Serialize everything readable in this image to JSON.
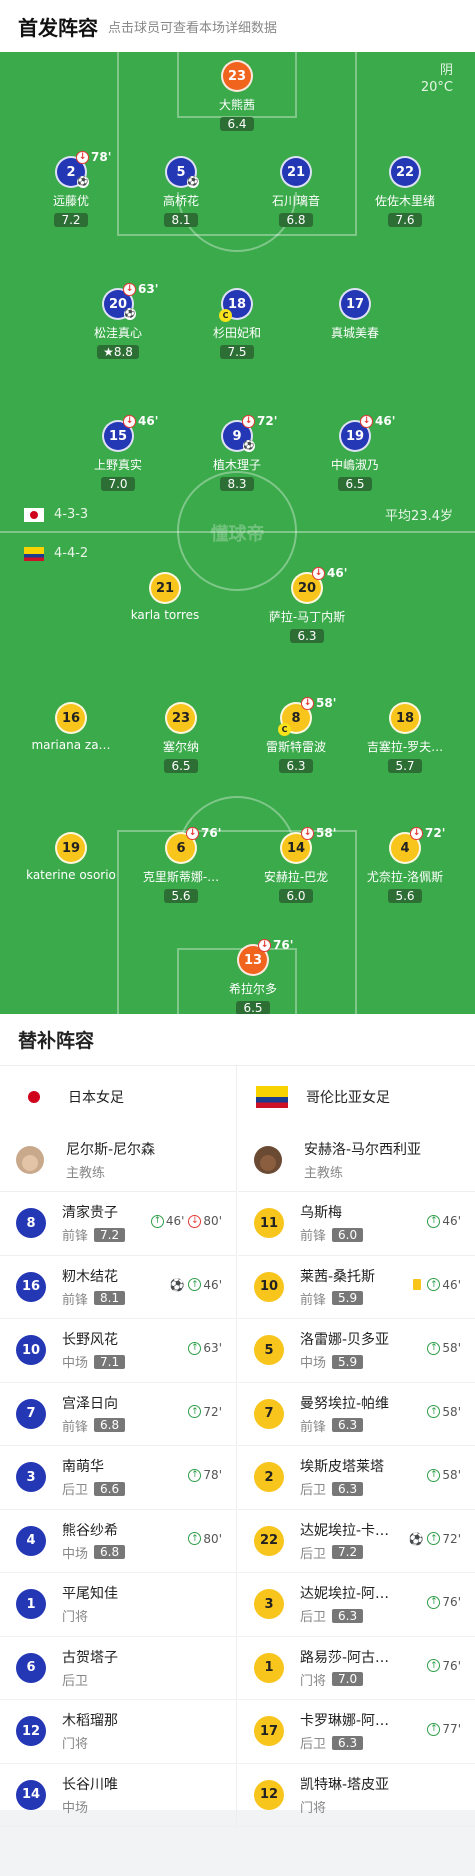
{
  "header": {
    "title": "首发阵容",
    "subtitle": "点击球员可查看本场详细数据"
  },
  "weather": {
    "condition": "阴",
    "temp": "20°C"
  },
  "home": {
    "formation": "4-3-3",
    "avg_age": "平均23.4岁"
  },
  "away": {
    "formation": "4-4-2"
  },
  "watermark": "懂球帝",
  "players": [
    {
      "num": "23",
      "name": "大熊茜",
      "rating": "6.4",
      "color": "orange"
    },
    {
      "num": "2",
      "name": "远藤优",
      "rating": "7.2",
      "color": "blue",
      "sub": "78'",
      "ball": true
    },
    {
      "num": "5",
      "name": "高桥花",
      "rating": "8.1",
      "color": "blue",
      "ball": true
    },
    {
      "num": "21",
      "name": "石川璃音",
      "rating": "6.8",
      "color": "blue"
    },
    {
      "num": "22",
      "name": "佐佐木里绪",
      "rating": "7.6",
      "color": "blue"
    },
    {
      "num": "20",
      "name": "松洼真心",
      "rating": "8.8",
      "color": "blue",
      "sub": "63'",
      "ball": true,
      "star": true
    },
    {
      "num": "18",
      "name": "杉田妃和",
      "rating": "7.5",
      "color": "blue",
      "captain": true
    },
    {
      "num": "17",
      "name": "真城美春",
      "rating": "",
      "color": "blue"
    },
    {
      "num": "15",
      "name": "上野真实",
      "rating": "7.0",
      "color": "blue",
      "sub": "46'"
    },
    {
      "num": "9",
      "name": "植木理子",
      "rating": "8.3",
      "color": "blue",
      "sub": "72'",
      "ball": true
    },
    {
      "num": "19",
      "name": "中嶋淑乃",
      "rating": "6.5",
      "color": "blue",
      "sub": "46'"
    },
    {
      "num": "21",
      "name": "karla torres",
      "rating": "",
      "color": "yellow"
    },
    {
      "num": "20",
      "name": "萨拉-马丁内斯",
      "rating": "6.3",
      "color": "yellow",
      "sub": "46'"
    },
    {
      "num": "16",
      "name": "mariana za…",
      "rating": "",
      "color": "yellow"
    },
    {
      "num": "23",
      "name": "塞尔纳",
      "rating": "6.5",
      "color": "yellow"
    },
    {
      "num": "8",
      "name": "雷斯特雷波",
      "rating": "6.3",
      "color": "yellow",
      "sub": "58'",
      "captain": true
    },
    {
      "num": "18",
      "name": "吉塞拉-罗夫…",
      "rating": "5.7",
      "color": "yellow"
    },
    {
      "num": "19",
      "name": "katerine osorio",
      "rating": "",
      "color": "yellow"
    },
    {
      "num": "6",
      "name": "克里斯蒂娜-…",
      "rating": "5.6",
      "color": "yellow",
      "sub": "76'"
    },
    {
      "num": "14",
      "name": "安赫拉-巴龙",
      "rating": "6.0",
      "color": "yellow",
      "sub": "58'"
    },
    {
      "num": "4",
      "name": "尤奈拉-洛佩斯",
      "rating": "5.6",
      "color": "yellow",
      "sub": "72'"
    },
    {
      "num": "13",
      "name": "希拉尔多",
      "rating": "6.5",
      "color": "orange",
      "sub": "76'"
    }
  ],
  "subs": {
    "title": "替补阵容",
    "home": {
      "team": "日本女足",
      "coach": {
        "name": "尼尔斯-尼尔森",
        "role": "主教练"
      },
      "list": [
        {
          "num": "8",
          "name": "清家贵子",
          "pos": "前锋",
          "rating": "7.2",
          "in": "46'",
          "out": "80'"
        },
        {
          "num": "16",
          "name": "籾木结花",
          "pos": "前锋",
          "rating": "8.1",
          "in": "46'",
          "ball": true
        },
        {
          "num": "10",
          "name": "长野风花",
          "pos": "中场",
          "rating": "7.1",
          "in": "63'"
        },
        {
          "num": "7",
          "name": "宫泽日向",
          "pos": "前锋",
          "rating": "6.8",
          "in": "72'"
        },
        {
          "num": "3",
          "name": "南萌华",
          "pos": "后卫",
          "rating": "6.6",
          "in": "78'"
        },
        {
          "num": "4",
          "name": "熊谷纱希",
          "pos": "中场",
          "rating": "6.8",
          "in": "80'"
        },
        {
          "num": "1",
          "name": "平尾知佳",
          "pos": "门将",
          "rating": ""
        },
        {
          "num": "6",
          "name": "古贺塔子",
          "pos": "后卫",
          "rating": ""
        },
        {
          "num": "12",
          "name": "木稻瑠那",
          "pos": "门将",
          "rating": ""
        },
        {
          "num": "14",
          "name": "长谷川唯",
          "pos": "中场",
          "rating": ""
        }
      ]
    },
    "away": {
      "team": "哥伦比亚女足",
      "coach": {
        "name": "安赫洛-马尔西利亚",
        "role": "主教练"
      },
      "list": [
        {
          "num": "11",
          "name": "乌斯梅",
          "pos": "前锋",
          "rating": "6.0",
          "in": "46'"
        },
        {
          "num": "10",
          "name": "莱茜-桑托斯",
          "pos": "前锋",
          "rating": "5.9",
          "in": "46'",
          "yellow": true
        },
        {
          "num": "5",
          "name": "洛雷娜-贝多亚",
          "pos": "中场",
          "rating": "5.9",
          "in": "58'"
        },
        {
          "num": "7",
          "name": "曼努埃拉-帕维",
          "pos": "前锋",
          "rating": "6.3",
          "in": "58'"
        },
        {
          "num": "2",
          "name": "埃斯皮塔莱塔",
          "pos": "后卫",
          "rating": "6.3",
          "in": "58'"
        },
        {
          "num": "22",
          "name": "达妮埃拉-卡…",
          "pos": "后卫",
          "rating": "7.2",
          "in": "72'",
          "ball": true
        },
        {
          "num": "3",
          "name": "达妮埃拉-阿…",
          "pos": "后卫",
          "rating": "6.3",
          "in": "76'"
        },
        {
          "num": "1",
          "name": "路易莎-阿古…",
          "pos": "门将",
          "rating": "7.0",
          "in": "76'"
        },
        {
          "num": "17",
          "name": "卡罗琳娜-阿…",
          "pos": "后卫",
          "rating": "6.3",
          "in": "77'"
        },
        {
          "num": "12",
          "name": "凯特琳-塔皮亚",
          "pos": "门将",
          "rating": ""
        }
      ]
    }
  }
}
